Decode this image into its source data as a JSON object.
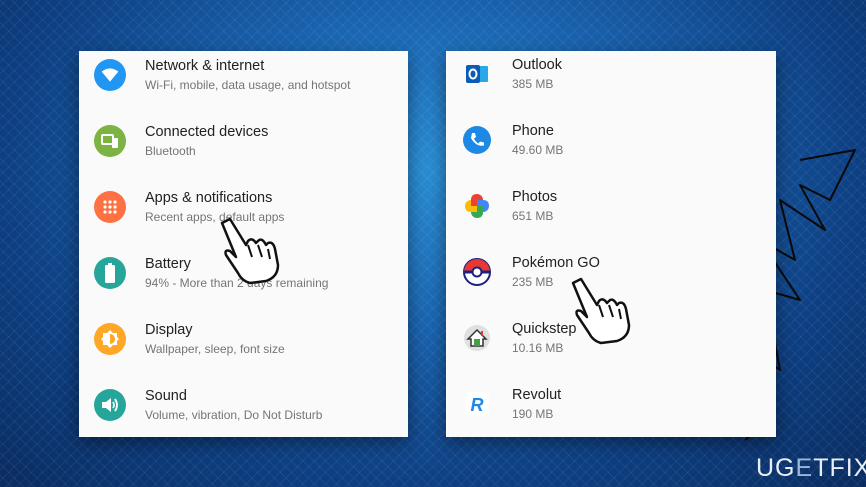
{
  "settings": {
    "items": [
      {
        "title": "Network & internet",
        "subtitle": "Wi-Fi, mobile, data usage, and hotspot",
        "icon": "wifi-icon",
        "color": "#2196f3"
      },
      {
        "title": "Connected devices",
        "subtitle": "Bluetooth",
        "icon": "devices-icon",
        "color": "#7cb342"
      },
      {
        "title": "Apps & notifications",
        "subtitle": "Recent apps, default apps",
        "icon": "apps-icon",
        "color": "#ff7043"
      },
      {
        "title": "Battery",
        "subtitle": "94% - More than 2 days remaining",
        "icon": "battery-icon",
        "color": "#26a69a"
      },
      {
        "title": "Display",
        "subtitle": "Wallpaper, sleep, font size",
        "icon": "brightness-icon",
        "color": "#ffa726"
      },
      {
        "title": "Sound",
        "subtitle": "Volume, vibration, Do Not Disturb",
        "icon": "volume-icon",
        "color": "#26a69a"
      }
    ]
  },
  "apps": {
    "items": [
      {
        "name": "Outlook",
        "size": "385 MB",
        "icon": "outlook-icon"
      },
      {
        "name": "Phone",
        "size": "49.60 MB",
        "icon": "phone-icon"
      },
      {
        "name": "Photos",
        "size": "651 MB",
        "icon": "photos-icon"
      },
      {
        "name": "Pokémon GO",
        "size": "235 MB",
        "icon": "pokeball-icon"
      },
      {
        "name": "Quickstep",
        "size": "10.16 MB",
        "icon": "home-icon"
      },
      {
        "name": "Revolut",
        "size": "190 MB",
        "icon": "revolut-icon"
      }
    ]
  },
  "watermark": {
    "part1": "UG",
    "part2": "E",
    "part3": "TFIX"
  }
}
